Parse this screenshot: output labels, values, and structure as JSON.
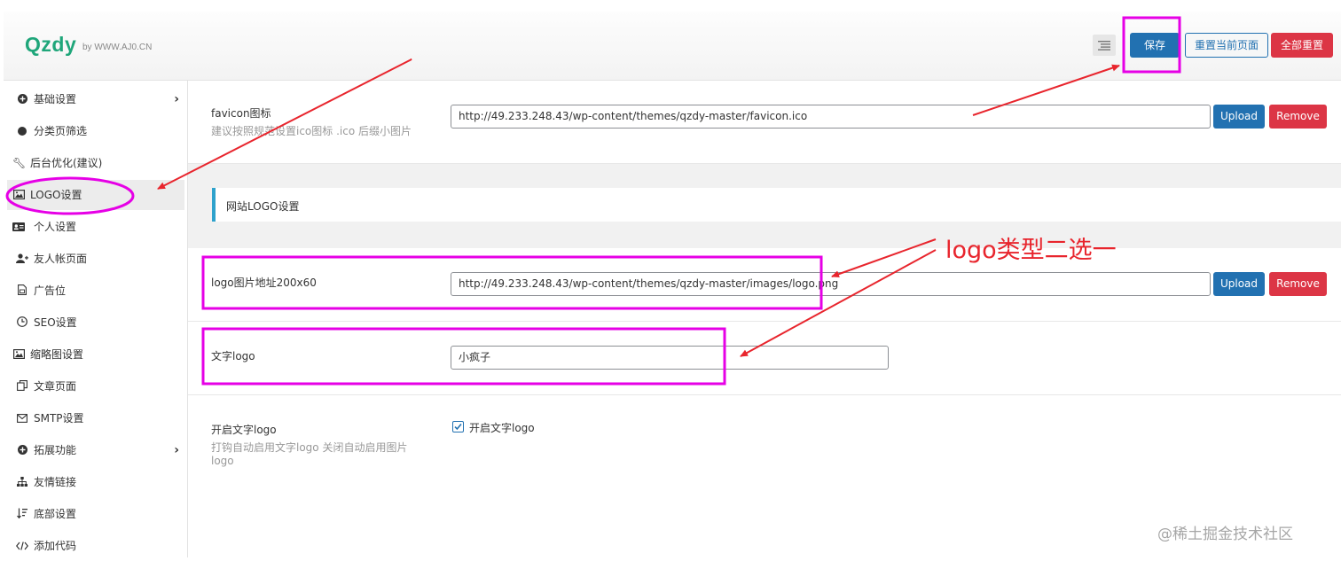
{
  "header": {
    "brand": "Qzdy",
    "brand_sub": "by WWW.AJ0.CN",
    "save_label": "保存",
    "reset_page_label": "重置当前页面",
    "reset_all_label": "全部重置"
  },
  "sidebar": {
    "items": [
      {
        "label": "基础设置",
        "icon": "plus-circle-icon",
        "has_arrow": true
      },
      {
        "label": "分类页筛选",
        "icon": "dot-icon"
      },
      {
        "label": "后台优化(建议)",
        "icon": "wrench-icon"
      },
      {
        "label": "LOGO设置",
        "icon": "image-icon",
        "active": true
      },
      {
        "label": "个人设置",
        "icon": "id-card-icon"
      },
      {
        "label": "友人帐页面",
        "icon": "user-plus-icon"
      },
      {
        "label": "广告位",
        "icon": "file-icon"
      },
      {
        "label": "SEO设置",
        "icon": "clock-icon"
      },
      {
        "label": "缩略图设置",
        "icon": "image-icon"
      },
      {
        "label": "文章页面",
        "icon": "copy-icon"
      },
      {
        "label": "SMTP设置",
        "icon": "envelope-icon"
      },
      {
        "label": "拓展功能",
        "icon": "plus-circle-icon",
        "has_arrow": true
      },
      {
        "label": "友情链接",
        "icon": "sitemap-icon"
      },
      {
        "label": "底部设置",
        "icon": "sort-icon"
      },
      {
        "label": "添加代码",
        "icon": "code-icon"
      }
    ]
  },
  "main": {
    "favicon": {
      "title": "favicon图标",
      "desc": "建议按照规范设置ico图标 .ico 后缀小图片",
      "value": "http://49.233.248.43/wp-content/themes/qzdy-master/favicon.ico",
      "upload_label": "Upload",
      "remove_label": "Remove"
    },
    "section_title": "网站LOGO设置",
    "logo_image": {
      "title": "logo图片地址200x60",
      "value": "http://49.233.248.43/wp-content/themes/qzdy-master/images/logo.png",
      "upload_label": "Upload",
      "remove_label": "Remove"
    },
    "text_logo": {
      "title": "文字logo",
      "value": "小疯子"
    },
    "enable_text_logo": {
      "title": "开启文字logo",
      "desc": "打钩自动启用文字logo 关闭自动启用图片logo",
      "checkbox_label": "开启文字logo",
      "checked": true
    }
  },
  "annotation": {
    "text": "logo类型二选一",
    "arrow_color": "#e8252d",
    "highlight_color": "#e600e6"
  },
  "watermark": "@稀土掘金技术社区"
}
